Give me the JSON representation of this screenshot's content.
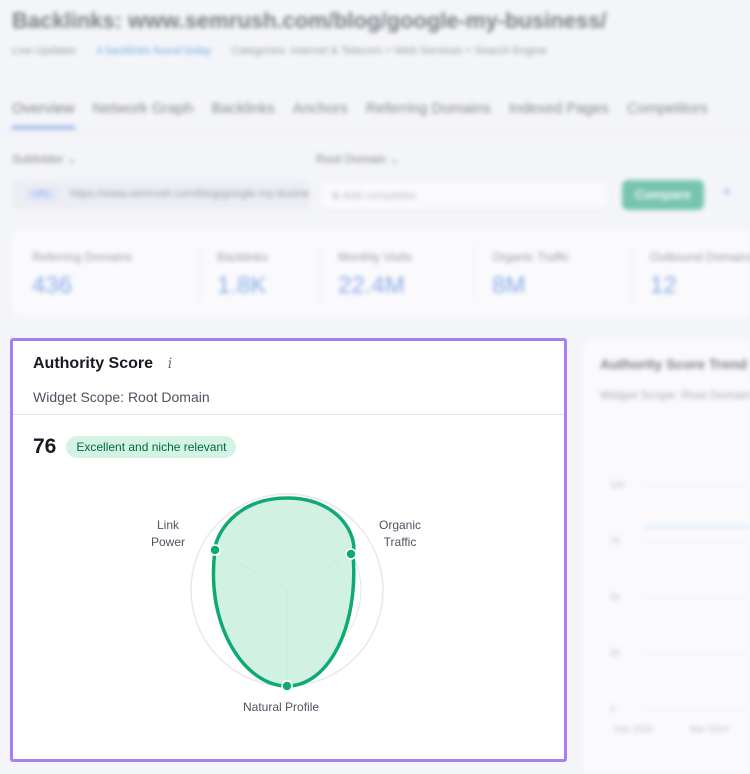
{
  "background": {
    "title": "Backlinks: www.semrush.com/blog/google-my-business/",
    "subrow": {
      "updates": "Live Updates",
      "link": "4 backlinks found today",
      "categories": "Categories: Internet & Telecom > Web Services > Search Engine"
    },
    "tabs": [
      "Overview",
      "Network Graph",
      "Backlinks",
      "Anchors",
      "Referring Domains",
      "Indexed Pages",
      "Competitors"
    ],
    "selector_left": "Subfolder",
    "selector_right": "Root Domain",
    "url_tag": "URL",
    "url_value": "https://www.semrush.com/blog/google-my-business/",
    "compare_placeholder": "Add competitor",
    "compare_button": "Compare",
    "plus": "+",
    "metrics": [
      {
        "label": "Referring Domains",
        "value": "436"
      },
      {
        "label": "Backlinks",
        "value": "1.8K"
      },
      {
        "label": "Monthly Visits",
        "value": "22.4M"
      },
      {
        "label": "Organic Traffic",
        "value": "8M"
      },
      {
        "label": "Outbound Domains",
        "value": "12"
      }
    ],
    "right_panel": {
      "title": "Authority Score Trend",
      "scope": "Widget Scope: Root Domain",
      "y_labels": [
        "100",
        "75",
        "50",
        "25",
        "0"
      ],
      "x_labels": [
        "Dec 2023",
        "Mar 2024"
      ]
    }
  },
  "card": {
    "title": "Authority Score",
    "info_icon": "i",
    "scope": "Widget Scope: Root Domain",
    "score": "76",
    "badge": "Excellent and niche relevant",
    "radar": {
      "labels": {
        "link_power": [
          "Link",
          "Power"
        ],
        "organic_traffic": [
          "Organic",
          "Traffic"
        ],
        "natural_profile": "Natural Profile"
      }
    }
  },
  "colors": {
    "accent_green": "#0faa73",
    "radar_fill": "#c9f0de",
    "highlight_border": "#a97ff0",
    "blue": "#2c6bd8"
  }
}
